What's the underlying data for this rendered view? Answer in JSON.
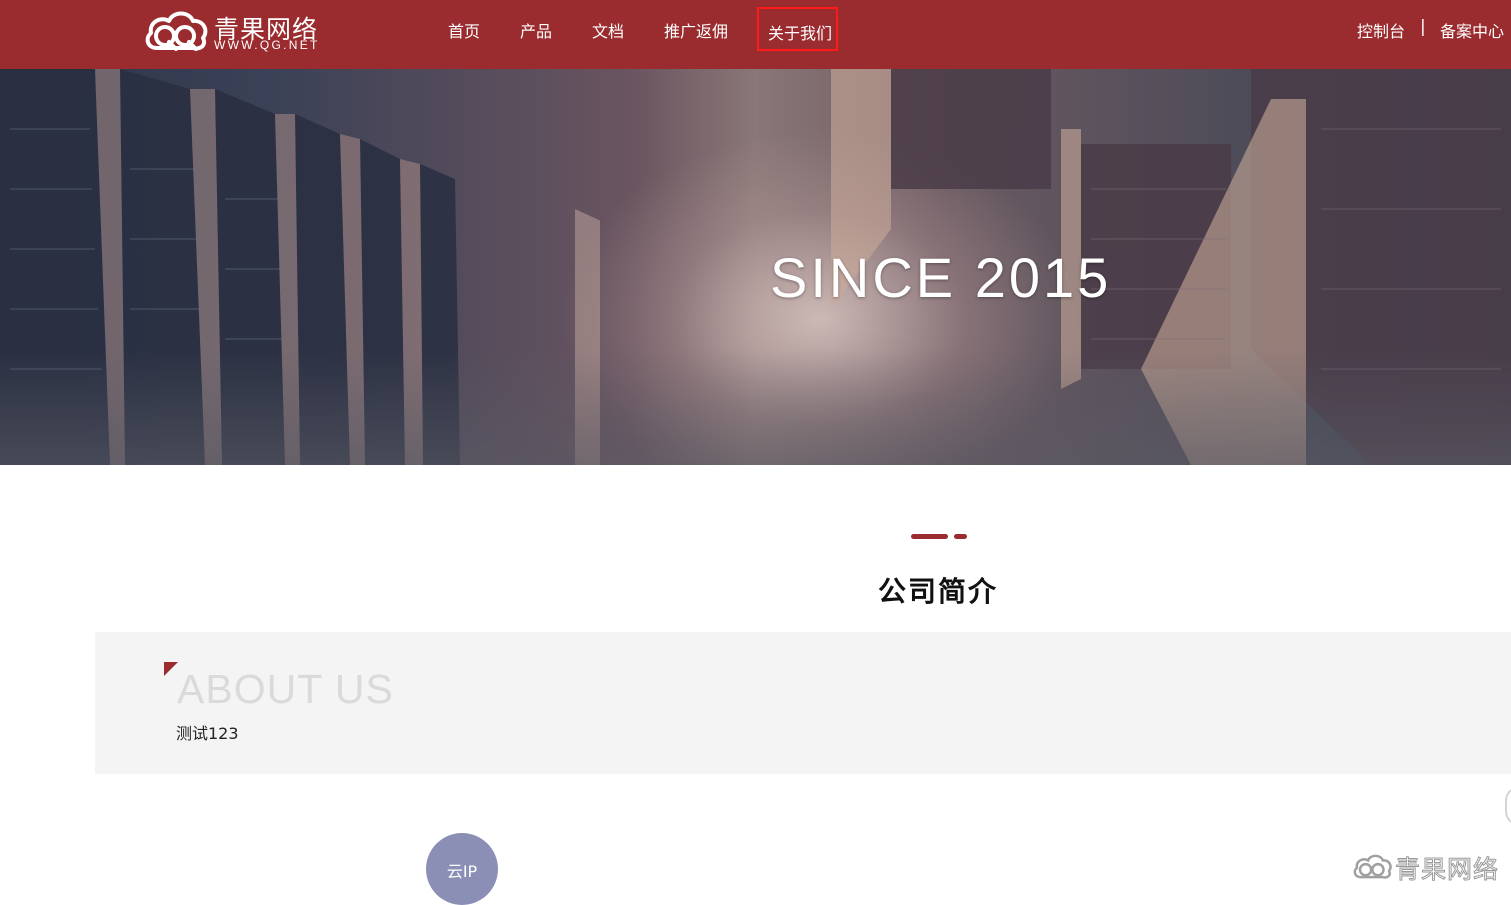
{
  "header": {
    "logo": {
      "name_cn": "青果网络",
      "name_en": "WWW.QG.NET"
    },
    "nav": [
      {
        "label": "首页"
      },
      {
        "label": "产品"
      },
      {
        "label": "文档"
      },
      {
        "label": "推广返佣"
      },
      {
        "label": "关于我们",
        "active": true
      }
    ],
    "right_links": [
      {
        "label": "控制台"
      },
      {
        "label": "备案中心"
      }
    ],
    "separator": "|"
  },
  "banner": {
    "headline": "SINCE 2015"
  },
  "section": {
    "title": "公司简介"
  },
  "about": {
    "title": "ABOUT US",
    "content": "测试123"
  },
  "bottom": {
    "cloud_ip_label": "云IP",
    "watermark_text": "青果网络"
  },
  "colors": {
    "brand": "#9a2b2e",
    "active_outline": "#ff1a1a",
    "about_bg": "#f3f4f3",
    "cloud_ip_bg": "#8b8fb6"
  }
}
